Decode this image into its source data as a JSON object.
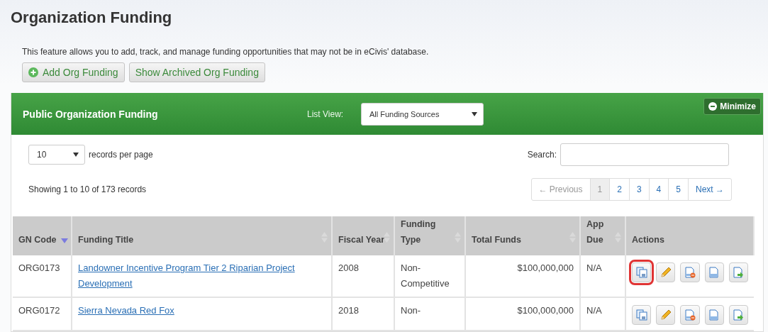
{
  "page": {
    "title": "Organization Funding",
    "description": "This feature allows you to add, track, and manage funding opportunities that may not be in eCivis' database.",
    "buttons": [
      {
        "label": "Add Org Funding",
        "kind": "add"
      },
      {
        "label": "Show Archived Org Funding",
        "kind": "plain"
      }
    ]
  },
  "panel": {
    "title": "Public Organization Funding",
    "list_view_label": "List View:",
    "list_view_value": "All Funding Sources",
    "minimize_label": "Minimize",
    "page_size": "10",
    "page_size_label": "records per page",
    "search_label": "Search:",
    "summary": "Showing 1 to 10 of 173 records",
    "pagination": [
      {
        "label": "← Previous",
        "disabled": true,
        "selected": false
      },
      {
        "label": "1",
        "disabled": false,
        "selected": true
      },
      {
        "label": "2",
        "disabled": false,
        "selected": false
      },
      {
        "label": "3",
        "disabled": false,
        "selected": false
      },
      {
        "label": "4",
        "disabled": false,
        "selected": false
      },
      {
        "label": "5",
        "disabled": false,
        "selected": false
      },
      {
        "label": "Next →",
        "disabled": false,
        "selected": false
      }
    ]
  },
  "table": {
    "columns": [
      {
        "label": "GN Code",
        "sortable": true,
        "sorted_descending": true
      },
      {
        "label": "Funding Title",
        "sortable": true,
        "sorted_descending": false
      },
      {
        "label": "Fiscal Year",
        "sortable": true,
        "sorted_descending": false
      },
      {
        "label": "Funding Type",
        "sortable": true,
        "sorted_descending": false
      },
      {
        "label": "Total Funds",
        "sortable": true,
        "sorted_descending": false
      },
      {
        "label": "App Due",
        "sortable": true,
        "sorted_descending": false
      },
      {
        "label": "Actions",
        "sortable": false
      }
    ],
    "rows": [
      {
        "code": "ORG0173",
        "title": "Landowner Incentive Program Tier 2 Riparian Project Development",
        "year": "2008",
        "type": "Non-Competitive",
        "funds": "$100,000,000",
        "due": "N/A",
        "actions": [
          {
            "kind": "copy",
            "highlighted": true
          },
          {
            "kind": "edit",
            "highlighted": false
          },
          {
            "kind": "remove",
            "highlighted": false
          },
          {
            "kind": "document",
            "highlighted": false
          },
          {
            "kind": "export",
            "highlighted": false
          }
        ]
      },
      {
        "code": "ORG0172",
        "title": "Sierra Nevada Red Fox",
        "year": "2018",
        "type": "Non-",
        "funds": "$100,000,000",
        "due": "N/A",
        "actions": [
          {
            "kind": "copy",
            "highlighted": false
          },
          {
            "kind": "edit",
            "highlighted": false
          },
          {
            "kind": "remove",
            "highlighted": false
          },
          {
            "kind": "document",
            "highlighted": false
          },
          {
            "kind": "export",
            "highlighted": false
          }
        ]
      }
    ]
  }
}
